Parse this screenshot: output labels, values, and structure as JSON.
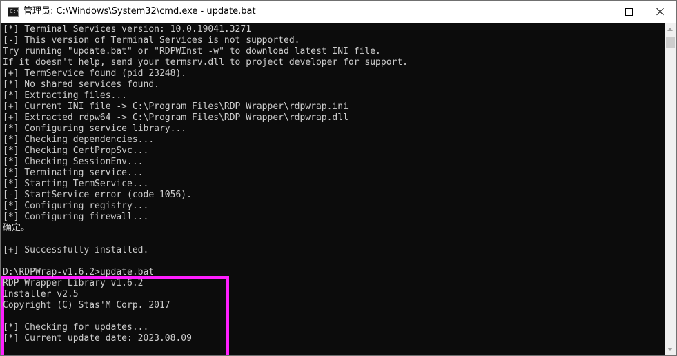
{
  "window": {
    "title": "管理员: C:\\Windows\\System32\\cmd.exe - update.bat",
    "icon_label": "C:\\",
    "icon": "cmd-icon"
  },
  "controls": {
    "minimize_icon": "minimize-icon",
    "maximize_icon": "maximize-icon",
    "close_icon": "close-icon"
  },
  "console": {
    "lines": [
      "[*] Terminal Services version: 10.0.19041.3271",
      "[-] This version of Terminal Services is not supported.",
      "Try running \"update.bat\" or \"RDPWInst -w\" to download latest INI file.",
      "If it doesn't help, send your termsrv.dll to project developer for support.",
      "[+] TermService found (pid 23248).",
      "[*] No shared services found.",
      "[*] Extracting files...",
      "[+] Current INI file -> C:\\Program Files\\RDP Wrapper\\rdpwrap.ini",
      "[+] Extracted rdpw64 -> C:\\Program Files\\RDP Wrapper\\rdpwrap.dll",
      "[*] Configuring service library...",
      "[*] Checking dependencies...",
      "[*] Checking CertPropSvc...",
      "[*] Checking SessionEnv...",
      "[*] Terminating service...",
      "[*] Starting TermService...",
      "[-] StartService error (code 1056).",
      "[*] Configuring registry...",
      "[*] Configuring firewall...",
      "确定。",
      "",
      "[+] Successfully installed.",
      "",
      "D:\\RDPWrap-v1.6.2>update.bat",
      "RDP Wrapper Library v1.6.2",
      "Installer v2.5",
      "Copyright (C) Stas'M Corp. 2017",
      "",
      "[*] Checking for updates...",
      "[*] Current update date: 2023.08.09"
    ]
  },
  "colors": {
    "console_bg": "#0c0c0c",
    "console_text": "#cccccc",
    "highlight_border": "#ff1eff"
  }
}
